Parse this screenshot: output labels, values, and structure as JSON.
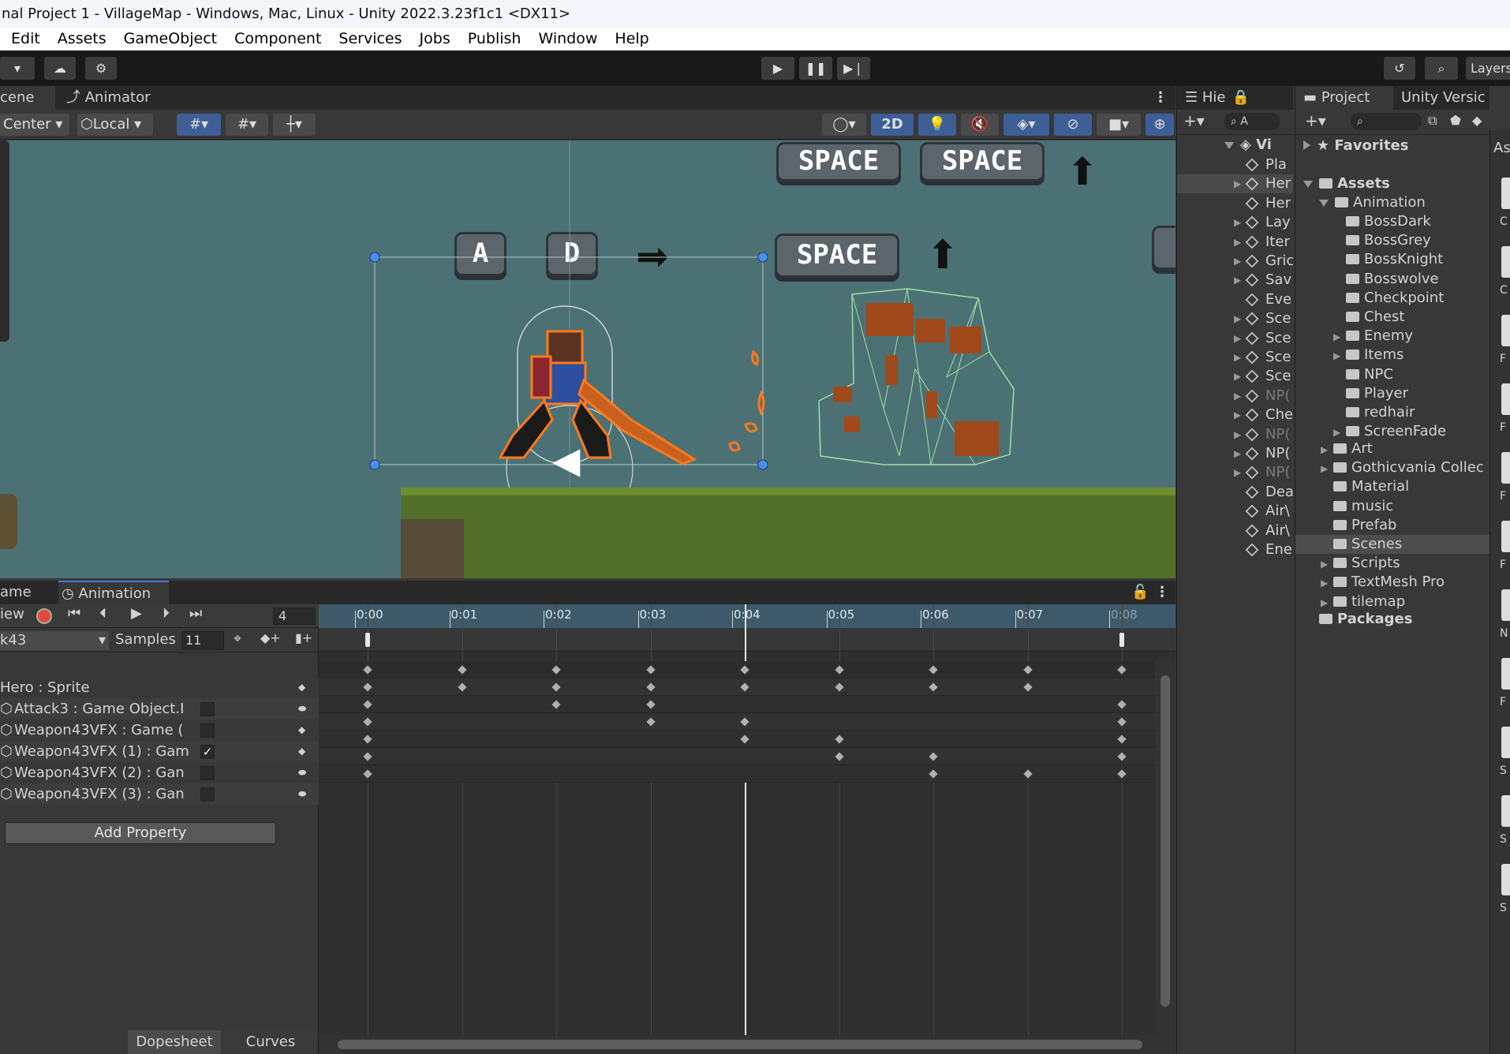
{
  "window": {
    "title": "nal Project 1 - VillageMap - Windows, Mac, Linux - Unity 2022.3.23f1c1 <DX11>"
  },
  "menu": [
    "Edit",
    "Assets",
    "GameObject",
    "Component",
    "Services",
    "Jobs",
    "Publish",
    "Window",
    "Help"
  ],
  "toolbar": {
    "layers_label": "Layers"
  },
  "scene": {
    "tab_scene": "cene",
    "tab_animator": "Animator",
    "pivot_label": "Center",
    "space_label": "Local",
    "mode_2d": "2D",
    "keys": {
      "space": "SPACE",
      "a": "A",
      "d": "D"
    }
  },
  "animation": {
    "tab_game": "ame",
    "tab_animation": "Animation",
    "preview_label": "iew",
    "frame_value": "4",
    "clip_name": "k43",
    "samples_label": "Samples",
    "samples_value": "11",
    "time_labels": [
      "0:00",
      "0:01",
      "0:02",
      "0:03",
      "0:04",
      "0:05",
      "0:06",
      "0:07",
      "0:08"
    ],
    "properties": [
      {
        "label": "Hero : Sprite",
        "checkbox": null
      },
      {
        "label": "Attack3 : Game Object.I",
        "checkbox": false
      },
      {
        "label": "Weapon43VFX : Game (",
        "checkbox": false
      },
      {
        "label": "Weapon43VFX (1) : Gam",
        "checkbox": true
      },
      {
        "label": "Weapon43VFX (2) : Gan",
        "checkbox": false
      },
      {
        "label": "Weapon43VFX (3) : Gan",
        "checkbox": false
      }
    ],
    "keyframes": [
      [
        0,
        1,
        2,
        3,
        4,
        5,
        6,
        7,
        8
      ],
      [
        0,
        1,
        2,
        3,
        4,
        5,
        6,
        7
      ],
      [
        0,
        2,
        3,
        8
      ],
      [
        0,
        3,
        4,
        8
      ],
      [
        0,
        4,
        5,
        8
      ],
      [
        0,
        5,
        6,
        8
      ],
      [
        0,
        6,
        7,
        8
      ]
    ],
    "add_property": "Add Property",
    "dopesheet": "Dopesheet",
    "curves": "Curves"
  },
  "hierarchy": {
    "tab": "Hie",
    "search_placeholder": "A",
    "root": "Vi",
    "items": [
      {
        "label": "Pla",
        "arrow": false,
        "dim": false
      },
      {
        "label": "Her",
        "arrow": true,
        "dim": false
      },
      {
        "label": "Her",
        "arrow": false,
        "dim": false
      },
      {
        "label": "Lay",
        "arrow": true,
        "dim": false
      },
      {
        "label": "Iter",
        "arrow": true,
        "dim": false
      },
      {
        "label": "Gric",
        "arrow": true,
        "dim": false
      },
      {
        "label": "Sav",
        "arrow": true,
        "dim": false
      },
      {
        "label": "Eve",
        "arrow": false,
        "dim": false
      },
      {
        "label": "Sce",
        "arrow": true,
        "dim": false
      },
      {
        "label": "Sce",
        "arrow": true,
        "dim": false
      },
      {
        "label": "Sce",
        "arrow": true,
        "dim": false
      },
      {
        "label": "Sce",
        "arrow": true,
        "dim": false
      },
      {
        "label": "NP(",
        "arrow": true,
        "dim": true
      },
      {
        "label": "Che",
        "arrow": true,
        "dim": false
      },
      {
        "label": "NP(",
        "arrow": true,
        "dim": true
      },
      {
        "label": "NP(",
        "arrow": true,
        "dim": false
      },
      {
        "label": "NP(",
        "arrow": true,
        "dim": true
      },
      {
        "label": "Dea",
        "arrow": false,
        "dim": false
      },
      {
        "label": "Air\\",
        "arrow": false,
        "dim": false
      },
      {
        "label": "Air\\",
        "arrow": false,
        "dim": false
      },
      {
        "label": "Ene",
        "arrow": false,
        "dim": false
      }
    ]
  },
  "project": {
    "tab": "Project",
    "tab_version": "Unity Versic",
    "favorites": "Favorites",
    "assets": "Assets",
    "animation_folder": "Animation",
    "animation_children": [
      {
        "label": "BossDark",
        "arrow": false
      },
      {
        "label": "BossGrey",
        "arrow": false
      },
      {
        "label": "BossKnight",
        "arrow": false
      },
      {
        "label": "Bosswolve",
        "arrow": false
      },
      {
        "label": "Checkpoint",
        "arrow": false
      },
      {
        "label": "Chest",
        "arrow": false
      },
      {
        "label": "Enemy",
        "arrow": true
      },
      {
        "label": "Items",
        "arrow": true
      },
      {
        "label": "NPC",
        "arrow": false
      },
      {
        "label": "Player",
        "arrow": false
      },
      {
        "label": "redhair",
        "arrow": false
      },
      {
        "label": "ScreenFade",
        "arrow": true
      }
    ],
    "asset_folders": [
      {
        "label": "Art",
        "arrow": true,
        "selected": false
      },
      {
        "label": "Gothicvania Collec",
        "arrow": true,
        "selected": false
      },
      {
        "label": "Material",
        "arrow": false,
        "selected": false
      },
      {
        "label": "music",
        "arrow": false,
        "selected": false
      },
      {
        "label": "Prefab",
        "arrow": false,
        "selected": false
      },
      {
        "label": "Scenes",
        "arrow": false,
        "selected": true
      },
      {
        "label": "Scripts",
        "arrow": true,
        "selected": false
      },
      {
        "label": "TextMesh Pro",
        "arrow": true,
        "selected": false
      },
      {
        "label": "tilemap",
        "arrow": true,
        "selected": false
      }
    ],
    "packages": "Packages",
    "right_header": "As",
    "right_letters": [
      "C",
      "C",
      "F",
      "F",
      "F",
      "F",
      "N",
      "F",
      "S",
      "S",
      "S"
    ]
  },
  "colors": {
    "accent": "#3e5f96",
    "record": "#e24a3b",
    "selection_outline": "#ff7a1a",
    "collider": "#9fe6a0"
  }
}
